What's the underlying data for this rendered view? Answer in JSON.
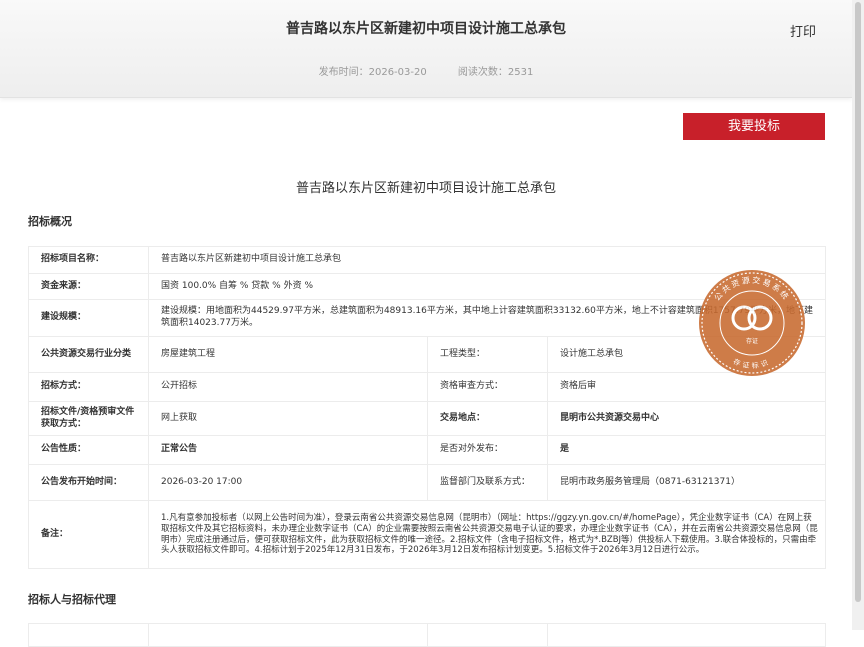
{
  "header": {
    "title": "普吉路以东片区新建初中项目设计施工总承包",
    "publish_time_label": "发布时间：2026-03-20",
    "read_count_label": "阅读次数：2531",
    "print_label": "打印"
  },
  "bid_button_label": "我要投标",
  "project_title": "普吉路以东片区新建初中项目设计施工总承包",
  "section_overview": "招标概况",
  "section_agent": "招标人与招标代理",
  "table": {
    "project_name_label": "招标项目名称：",
    "project_name": "普吉路以东片区新建初中项目设计施工总承包",
    "fund_label": "资金来源：",
    "fund": "国资 100.0% 自筹 % 贷款 % 外资 %",
    "scale_label": "建设规模：",
    "scale": "建设规模：用地面积为44529.97平方米，总建筑面积为48913.16平方米，其中地上计容建筑面积33132.60平方米，地上不计容建筑面积1757.79平方米，地下建筑面积14023.77万米。",
    "category_label": "公共资源交易行业分类",
    "category": "房屋建筑工程",
    "eng_type_label": "工程类型：",
    "eng_type": "设计施工总承包",
    "method_label": "招标方式：",
    "method": "公开招标",
    "review_label": "资格审查方式：",
    "review": "资格后审",
    "docs_label": "招标文件/资格预审文件获取方式：",
    "docs": "网上获取",
    "location_label": "交易地点：",
    "location": "昆明市公共资源交易中心",
    "nature_label": "公告性质：",
    "nature": "正常公告",
    "external_label": "是否对外发布：",
    "external": "是",
    "start_label": "公告发布开始时间：",
    "start": "2026-03-20 17:00",
    "supervisor_label": "监督部门及联系方式：",
    "supervisor": "昆明市政务服务管理局（0871-63121371）",
    "note_label": "备注：",
    "note": "1.凡有意参加投标者（以网上公告时间为准），登录云南省公共资源交易信息网（昆明市）（网址：https://ggzy.yn.gov.cn/#/homePage），凭企业数字证书（CA）在网上获取招标文件及其它招标资料，未办理企业数字证书（CA）的企业需要按照云南省公共资源交易电子认证的要求，办理企业数字证书（CA），并在云南省公共资源交易信息网（昆明市）完成注册通过后，便可获取招标文件，此为获取招标文件的唯一途径。2.招标文件（含电子招标文件，格式为*.BZBJ等）供投标人下载使用。3.联合体投标的，只需由牵头人获取招标文件即可。4.招标计划于2025年12月31日发布，于2026年3月12日发布招标计划变更。5.招标文件于2026年3月12日进行公示。"
  },
  "seal": {
    "ring_text": "公共资源交易系统",
    "bottom_text": "存证标识",
    "center_text": "存证"
  },
  "colors": {
    "accent": "#c8202a",
    "link_red": "#d0021b",
    "seal": "#c86a2f"
  }
}
